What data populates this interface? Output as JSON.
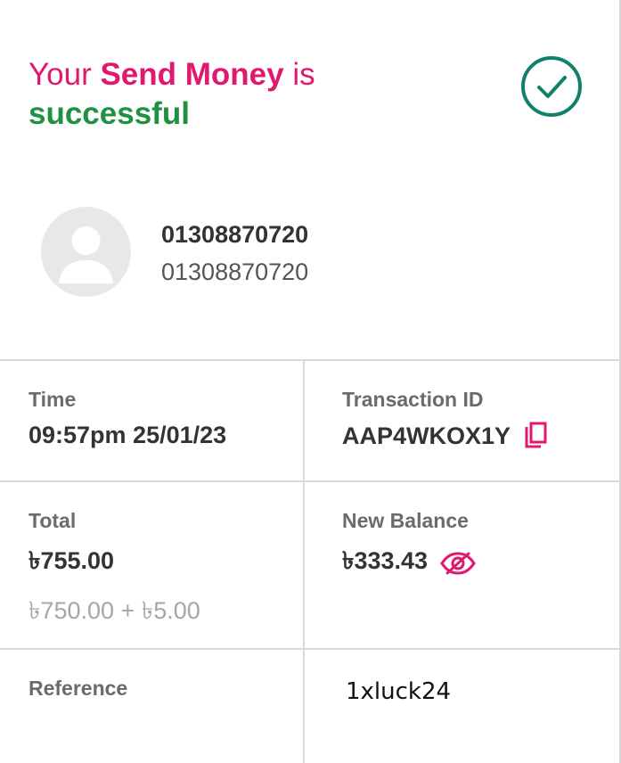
{
  "header": {
    "prefix": "Your ",
    "emphasis": "Send Money",
    "suffix": " is",
    "status": "successful"
  },
  "icons": {
    "status": "check-circle-icon",
    "avatar": "person-icon",
    "copy": "copy-icon",
    "visibility": "eye-off-icon"
  },
  "colors": {
    "brand": "#e0196f",
    "success": "#1f9140",
    "check_ring": "#12806a"
  },
  "recipient": {
    "name": "01308870720",
    "number": "01308870720"
  },
  "details": {
    "time": {
      "label": "Time",
      "value": "09:57pm 25/01/23"
    },
    "transaction_id": {
      "label": "Transaction ID",
      "value": "AAP4WKOX1Y"
    },
    "total": {
      "label": "Total",
      "value": "৳755.00",
      "breakdown": "৳750.00 + ৳5.00"
    },
    "new_balance": {
      "label": "New Balance",
      "value": "৳333.43"
    },
    "reference": {
      "label": "Reference",
      "value": "1xluck24"
    }
  }
}
